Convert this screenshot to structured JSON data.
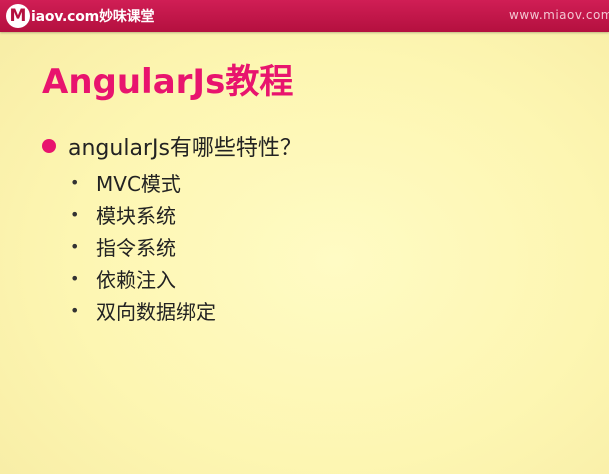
{
  "header": {
    "logo_mark": "M",
    "logo_text": "iaov.com妙味课堂",
    "url": "www.miaov.com",
    "accent_color": "#c0184a"
  },
  "slide": {
    "title": "AngularJs教程",
    "main_bullet": "angularJs有哪些特性？",
    "sub_items": [
      "MVC模式",
      "模块系统",
      "指令系统",
      "依赖注入",
      "双向数据绑定"
    ],
    "title_color": "#e8146e",
    "background_color": "#fdf7b4"
  }
}
